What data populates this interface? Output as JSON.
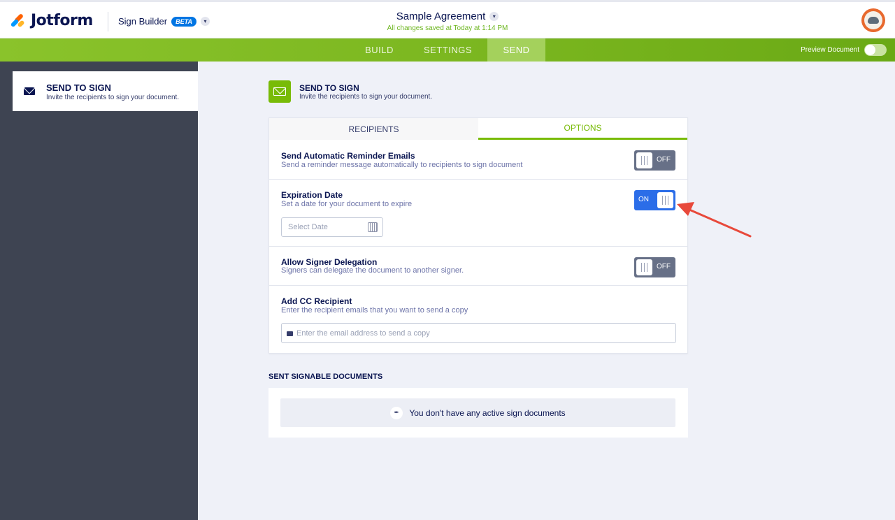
{
  "header": {
    "logo_text": "Jotform",
    "product": "Sign Builder",
    "beta_badge": "BETA",
    "document_title": "Sample Agreement",
    "save_status": "All changes saved at Today at 1:14 PM"
  },
  "nav": {
    "tabs": [
      {
        "label": "BUILD"
      },
      {
        "label": "SETTINGS"
      },
      {
        "label": "SEND",
        "active": true
      }
    ],
    "preview_label": "Preview Document"
  },
  "sidebar": {
    "items": [
      {
        "title": "SEND TO SIGN",
        "subtitle": "Invite the recipients to sign your document.",
        "icon": "envelope-icon",
        "active": true
      }
    ]
  },
  "main": {
    "title": "SEND TO SIGN",
    "subtitle": "Invite the recipients to sign your document.",
    "tabs": [
      {
        "label": "RECIPIENTS"
      },
      {
        "label": "OPTIONS",
        "active": true
      }
    ],
    "options": {
      "reminder": {
        "title": "Send Automatic Reminder Emails",
        "desc": "Send a reminder message automatically to recipients to sign document",
        "state": "OFF"
      },
      "expiration": {
        "title": "Expiration Date",
        "desc": "Set a date for your document to expire",
        "state": "ON",
        "date_placeholder": "Select Date"
      },
      "delegation": {
        "title": "Allow Signer Delegation",
        "desc": "Signers can delegate the document to another signer.",
        "state": "OFF"
      },
      "cc": {
        "title": "Add CC Recipient",
        "desc": "Enter the recipient emails that you want to send a copy",
        "placeholder": "Enter the email address to send a copy"
      }
    },
    "sent": {
      "title": "SENT SIGNABLE DOCUMENTS",
      "empty_text": "You don't have any active sign documents"
    }
  },
  "colors": {
    "accent_green": "#78bb07",
    "toggle_on": "#2b6de8",
    "toggle_off": "#677087",
    "sidebar_bg": "#3e4452",
    "annotation_arrow": "#e8493b"
  }
}
